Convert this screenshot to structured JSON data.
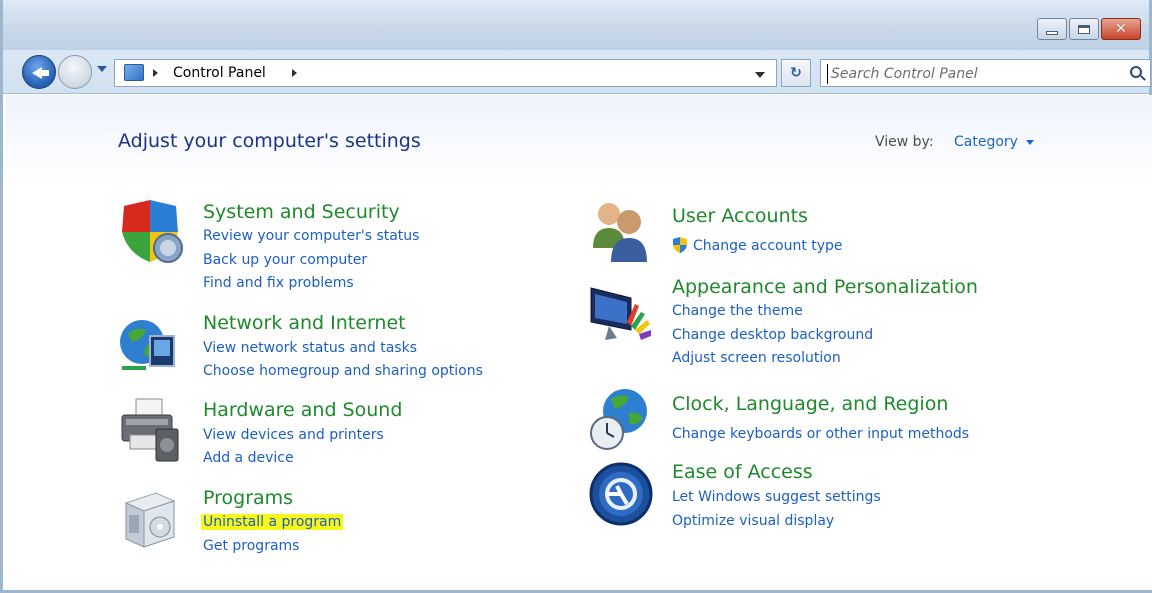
{
  "window": {
    "colors": {
      "frame": "#9fb6cf",
      "title": "#1e3287",
      "category": "#1e8a2b",
      "link": "#1c5fc4",
      "highlight": "#f7f71a"
    }
  },
  "navigation": {
    "breadcrumb": "Control Panel",
    "search_placeholder": "Search Control Panel"
  },
  "header": {
    "title": "Adjust your computer's settings",
    "view_by_label": "View by:",
    "view_by_value": "Category"
  },
  "categories": {
    "system_security": {
      "title": "System and Security",
      "icon": "shield-icon",
      "links": [
        "Review your computer's status",
        "Back up your computer",
        "Find and fix problems"
      ]
    },
    "network": {
      "title": "Network and Internet",
      "icon": "network-globe-icon",
      "links": [
        "View network status and tasks",
        "Choose homegroup and sharing options"
      ]
    },
    "hardware": {
      "title": "Hardware and Sound",
      "icon": "printer-icon",
      "links": [
        "View devices and printers",
        "Add a device"
      ]
    },
    "programs": {
      "title": "Programs",
      "icon": "programs-box-icon",
      "links": [
        "Uninstall a program",
        "Get programs"
      ]
    },
    "user_accounts": {
      "title": "User Accounts",
      "icon": "users-icon",
      "links": [
        "Change account type"
      ]
    },
    "appearance": {
      "title": "Appearance and Personalization",
      "icon": "monitor-paint-icon",
      "links": [
        "Change the theme",
        "Change desktop background",
        "Adjust screen resolution"
      ]
    },
    "clock": {
      "title": "Clock, Language, and Region",
      "icon": "globe-clock-icon",
      "links": [
        "Change keyboards or other input methods"
      ]
    },
    "ease": {
      "title": "Ease of Access",
      "icon": "ease-of-access-icon",
      "links": [
        "Let Windows suggest settings",
        "Optimize visual display"
      ]
    }
  }
}
